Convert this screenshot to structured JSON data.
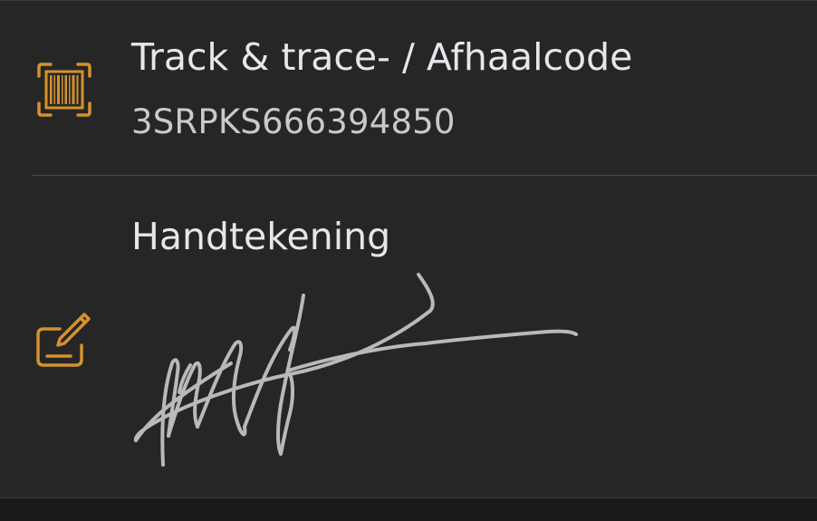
{
  "tracking": {
    "title": "Track & trace- / Afhaalcode",
    "code": "3SRPKS666394850",
    "icon": "barcode-scan-icon"
  },
  "signature": {
    "title": "Handtekening",
    "icon": "edit-signature-icon"
  },
  "colors": {
    "accent": "#d4912e",
    "card_background": "#262626",
    "page_background": "#1a1a1a",
    "title_text": "#e6e6ec",
    "value_text": "#c9c9ce",
    "signature_stroke": "#b9b9b7"
  }
}
